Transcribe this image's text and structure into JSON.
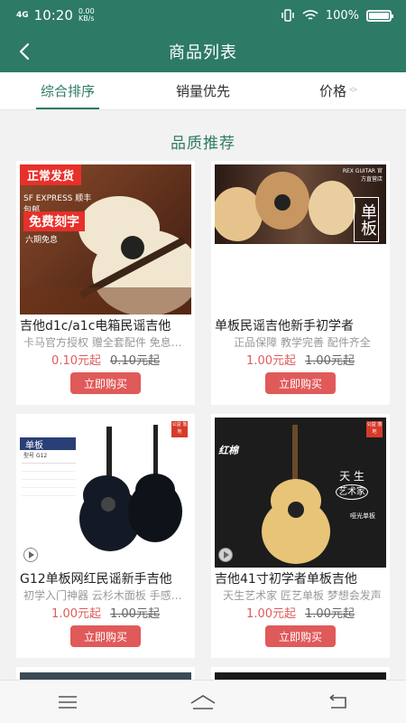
{
  "status_bar": {
    "signal": "4G",
    "time": "10:20",
    "speed_value": "0.00",
    "speed_unit": "KB/s",
    "battery": "100%"
  },
  "header": {
    "title": "商品列表"
  },
  "tabs": [
    {
      "label": "综合排序",
      "active": true
    },
    {
      "label": "销量优先",
      "active": false
    },
    {
      "label": "价格",
      "active": false
    }
  ],
  "section_title": "品质推荐",
  "products": [
    {
      "name": "吉他d1c/a1c电箱民谣吉他",
      "subtitle": "卡马官方授权 赠全套配件 免息分期",
      "price": "0.10元起",
      "original_price": "0.10元起",
      "buy_label": "立即购买",
      "image_text": {
        "ribbon": "正常发货",
        "brand": "SF EXPRESS 顺丰包邮",
        "promo": "免费刻字",
        "promo2": "六期免息"
      }
    },
    {
      "name": "单板民谣吉他新手初学者",
      "subtitle": "正品保障 教学完善 配件齐全",
      "price": "1.00元起",
      "original_price": "1.00元起",
      "buy_label": "立即购买",
      "image_text": {
        "tag": "REX GUITAR 官方直营店",
        "badge": "单板"
      }
    },
    {
      "name": "G12单板网红民谣新手吉他",
      "subtitle": "初学入门神器 云杉木面板 手感舒适",
      "price": "1.00元起",
      "original_price": "1.00元起",
      "buy_label": "立即购买",
      "image_text": {
        "header": "单板",
        "model_label": "型号",
        "model": "G12",
        "badge": "公益 落地"
      }
    },
    {
      "name": "吉他41寸初学者单板吉他",
      "subtitle": "天生艺术家 匠艺单板 梦想会发声",
      "price": "1.00元起",
      "original_price": "1.00元起",
      "buy_label": "立即购买",
      "image_text": {
        "brand": "红棉",
        "slogan1": "天",
        "slogan2": "生",
        "slogan3": "艺术家",
        "caption": "哑光单板",
        "badge": "公益 落地"
      }
    }
  ],
  "colors": {
    "primary": "#2d7a66",
    "price": "#e25b5b",
    "button": "#e05a5a"
  }
}
